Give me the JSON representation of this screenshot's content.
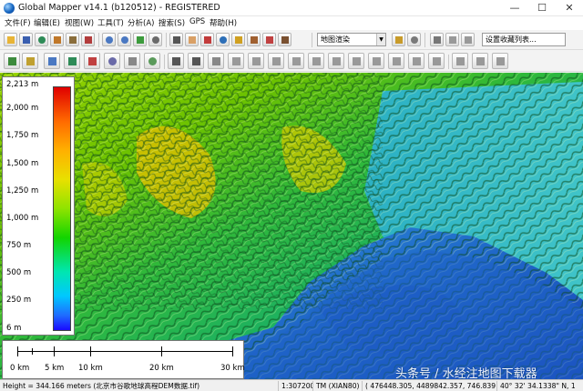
{
  "window": {
    "title": "Global Mapper v14.1 (b120512) - REGISTERED",
    "minimize_glyph": "—",
    "maximize_glyph": "☐",
    "close_glyph": "✕"
  },
  "menu": [
    "文件(F)",
    "编辑(E)",
    "视图(W)",
    "工具(T)",
    "分析(A)",
    "搜索(S)",
    "GPS",
    "帮助(H)"
  ],
  "toolbar": {
    "projection_select": "地图渲染",
    "bookmark_select": "设置收藏列表..."
  },
  "legend": {
    "labels": [
      "2,213 m",
      "2,000 m",
      "1,750 m",
      "1,500 m",
      "1,250 m",
      "1,000 m",
      "750 m",
      "500 m",
      "250 m",
      "6 m"
    ]
  },
  "scalebar": {
    "labels": [
      "0 km",
      "5 km",
      "10 km",
      "20 km",
      "30 km"
    ]
  },
  "watermark": "头条号 / 水经注地图下载器",
  "status": {
    "height_info": "Height = 344.166 meters (北京市谷歌地球高程DEM数据.tif)",
    "scale": "1:307200",
    "projection": "TM (XIAN80)",
    "coords": "( 476448.305, 4489842.357, 746.839 m )",
    "latlon": "40° 32' 34.1338\" N, 1"
  },
  "colors": {
    "legend_low": "#1a0aff",
    "legend_high": "#e00000",
    "water": "#1f6fcc"
  }
}
